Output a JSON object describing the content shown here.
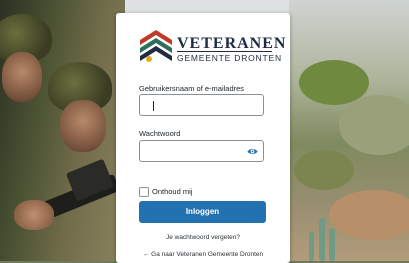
{
  "brand": {
    "line1": "VETERANEN",
    "line2": "GEMEENTE DRONTEN"
  },
  "login": {
    "username_label": "Gebruikersnaam of e-mailadres",
    "username_value": "",
    "password_label": "Wachtwoord",
    "password_value": "",
    "remember_label": "Onthoud mij",
    "submit_label": "Inloggen",
    "lost_password": "Je wachtwoord vergeten?",
    "back_link": "← Ga naar Veteranen Gemeente Dronten"
  },
  "colors": {
    "primary": "#2271b1",
    "brand_dark": "#1f2a44",
    "emblem_red": "#c0392b",
    "emblem_green": "#2e6e5a"
  },
  "icons": {
    "password_toggle": "eye-icon",
    "logo": "veteranen-emblem-icon"
  }
}
